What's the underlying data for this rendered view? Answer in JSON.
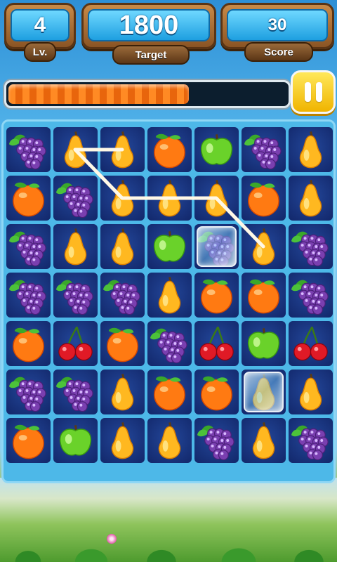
{
  "hud": {
    "level": {
      "value": "4",
      "label": "Lv."
    },
    "target": {
      "value": "1800",
      "label": "Target"
    },
    "score": {
      "value": "30",
      "label": "Score"
    }
  },
  "progress": {
    "fraction": 0.66
  },
  "pause": {
    "icon": "pause-icon"
  },
  "board": {
    "rows": 7,
    "cols": 7,
    "grid": [
      [
        "grape",
        "pear",
        "pear",
        "orange",
        "apple",
        "grape",
        "pear"
      ],
      [
        "orange",
        "grape",
        "pear",
        "pear",
        "pear",
        "orange",
        "pear"
      ],
      [
        "grape",
        "pear",
        "pear",
        "apple",
        "grape",
        "pear",
        "grape"
      ],
      [
        "grape",
        "grape",
        "grape",
        "pear",
        "orange",
        "orange",
        "grape"
      ],
      [
        "orange",
        "cherry",
        "orange",
        "grape",
        "cherry",
        "apple",
        "cherry"
      ],
      [
        "grape",
        "grape",
        "pear",
        "orange",
        "orange",
        "pear",
        "pear"
      ],
      [
        "orange",
        "apple",
        "pear",
        "pear",
        "grape",
        "pear",
        "grape"
      ]
    ],
    "frozen": [
      [
        2,
        4
      ],
      [
        5,
        5
      ]
    ],
    "selection_path": [
      [
        0,
        1
      ],
      [
        0,
        2
      ],
      [
        0,
        1
      ],
      [
        1,
        2
      ],
      [
        1,
        3
      ],
      [
        1,
        4
      ],
      [
        2,
        5
      ]
    ]
  },
  "colors": {
    "cell": "#162f7a",
    "path": "#fff8e6",
    "board": "#4db8e8"
  }
}
